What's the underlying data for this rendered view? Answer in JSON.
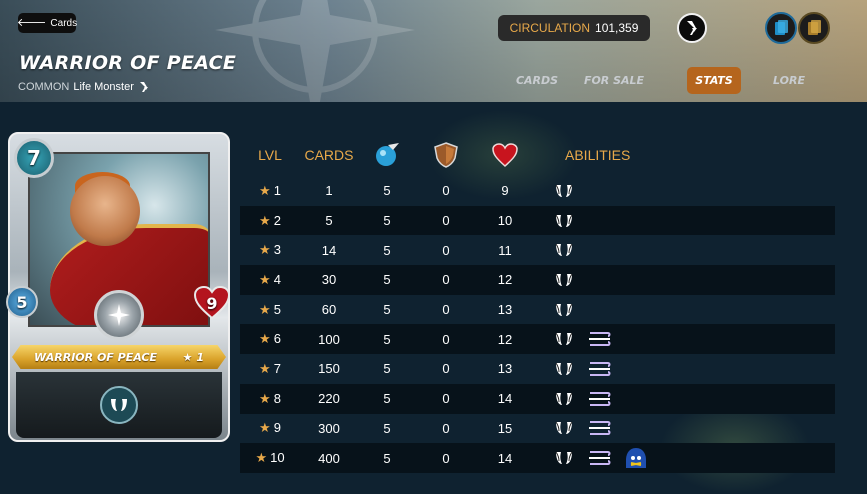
{
  "header": {
    "back_label": "Cards",
    "title": "WARRIOR OF PEACE",
    "rarity": "COMMON",
    "card_type": "Life Monster",
    "circulation_label": "CIRCULATION",
    "circulation_value": "101,359",
    "tabs": [
      {
        "label": "CARDS",
        "active": false
      },
      {
        "label": "FOR SALE",
        "active": false
      },
      {
        "label": "STATS",
        "active": true
      },
      {
        "label": "LORE",
        "active": false
      }
    ],
    "icons": [
      "hive-icon",
      "blue-cards-icon",
      "gold-cards-icon"
    ]
  },
  "card": {
    "mana": "7",
    "speed": "5",
    "health": "9",
    "name": "WARRIOR OF PEACE",
    "level_label": "★ 1",
    "ability_icon": "shield-ability-icon"
  },
  "stats": {
    "headers": {
      "lvl": "LVL",
      "cards": "CARDS",
      "speed_icon": "speed-icon",
      "armor_icon": "armor-icon",
      "health_icon": "health-icon",
      "abilities": "ABILITIES"
    },
    "rows": [
      {
        "lvl": "1",
        "cards": "1",
        "speed": "5",
        "armor": "0",
        "health": "9",
        "abilities": [
          "divine-shield"
        ]
      },
      {
        "lvl": "2",
        "cards": "5",
        "speed": "5",
        "armor": "0",
        "health": "10",
        "abilities": [
          "divine-shield"
        ]
      },
      {
        "lvl": "3",
        "cards": "14",
        "speed": "5",
        "armor": "0",
        "health": "11",
        "abilities": [
          "divine-shield"
        ]
      },
      {
        "lvl": "4",
        "cards": "30",
        "speed": "5",
        "armor": "0",
        "health": "12",
        "abilities": [
          "divine-shield"
        ]
      },
      {
        "lvl": "5",
        "cards": "60",
        "speed": "5",
        "armor": "0",
        "health": "13",
        "abilities": [
          "divine-shield"
        ]
      },
      {
        "lvl": "6",
        "cards": "100",
        "speed": "5",
        "armor": "0",
        "health": "12",
        "abilities": [
          "divine-shield",
          "swiftness"
        ]
      },
      {
        "lvl": "7",
        "cards": "150",
        "speed": "5",
        "armor": "0",
        "health": "13",
        "abilities": [
          "divine-shield",
          "swiftness"
        ]
      },
      {
        "lvl": "8",
        "cards": "220",
        "speed": "5",
        "armor": "0",
        "health": "14",
        "abilities": [
          "divine-shield",
          "swiftness"
        ]
      },
      {
        "lvl": "9",
        "cards": "300",
        "speed": "5",
        "armor": "0",
        "health": "15",
        "abilities": [
          "divine-shield",
          "swiftness"
        ]
      },
      {
        "lvl": "10",
        "cards": "400",
        "speed": "5",
        "armor": "0",
        "health": "14",
        "abilities": [
          "divine-shield",
          "swiftness",
          "cleanse"
        ]
      }
    ]
  },
  "colors": {
    "accent": "#e8a94a",
    "tab_active": "#b5651d",
    "row_dark": "#07121a",
    "background": "#0f2230"
  }
}
